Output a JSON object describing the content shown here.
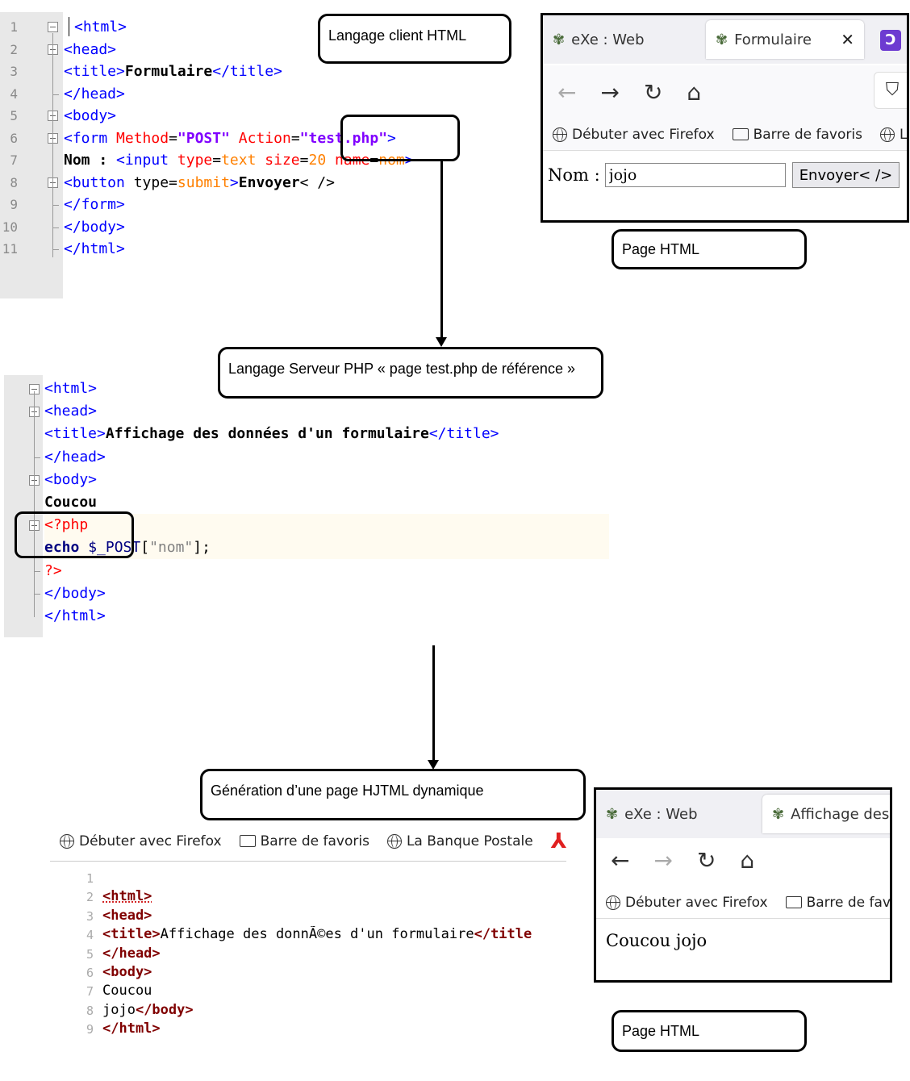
{
  "labels": {
    "client": "Langage client HTML",
    "page_html_1": "Page HTML",
    "server": "Langage Serveur PHP « page test.php de référence »",
    "generation": "Génération d’une page HJTML dynamique",
    "page_html_2": "Page HTML"
  },
  "editor1": {
    "lines": [
      {
        "n": "1",
        "html": "<span class=\"tag\">&lt;html&gt;</span>"
      },
      {
        "n": "2",
        "html": "<span class=\"tag\">&lt;head&gt;</span>"
      },
      {
        "n": "3",
        "html": "<span class=\"tag\">&lt;title&gt;</span><span class=\"bold\">Formulaire</span><span class=\"tag\">&lt;/title&gt;</span>"
      },
      {
        "n": "4",
        "html": "<span class=\"tag\">&lt;/head&gt;</span>"
      },
      {
        "n": "5",
        "html": "<span class=\"tag\">&lt;body&gt;</span>"
      },
      {
        "n": "6",
        "html": "<span class=\"tag\">&lt;form </span><span class=\"attr\">Method</span>=<span class=\"str\">\"POST\"</span> <span class=\"attr\">Action</span>=<span class=\"str\">\"test.php\"</span><span class=\"tag\">&gt;</span>"
      },
      {
        "n": "7",
        "html": "<span class=\"bold\">Nom : </span><span class=\"tag\">&lt;input </span><span class=\"attr\">type</span>=<span style=\"color:#ff8000\">text</span> <span class=\"attr\">size</span>=<span style=\"color:#ff8000\">20</span> <span class=\"attr\">name</span>=<span style=\"color:#ff8000\">nom</span><span class=\"tag\">&gt;</span>"
      },
      {
        "n": "8",
        "html": "<span class=\"tag\">&lt;button </span>type=<span style=\"color:#ff8000\">submit</span><span class=\"tag\">&gt;</span><span class=\"bold\">Envoyer</span>&lt; /&gt;"
      },
      {
        "n": "9",
        "html": "<span class=\"tag\">&lt;/form&gt;</span>"
      },
      {
        "n": "10",
        "html": "<span class=\"tag\">&lt;/body&gt;</span>"
      },
      {
        "n": "11",
        "html": "<span class=\"tag\">&lt;/html&gt;</span>"
      }
    ]
  },
  "editor2": {
    "lines": [
      {
        "html": "<span class=\"tag\">&lt;html&gt;</span>"
      },
      {
        "html": "<span class=\"tag\">&lt;head&gt;</span>"
      },
      {
        "html": "<span class=\"tag\">&lt;title&gt;</span><span class=\"bold\">Affichage des données d'un formulaire</span><span class=\"tag\">&lt;/title&gt;</span>"
      },
      {
        "html": "<span class=\"tag\">&lt;/head&gt;</span>"
      },
      {
        "html": "<span class=\"tag\">&lt;body&gt;</span>"
      },
      {
        "html": "<span class=\"bold\">Coucou</span>"
      },
      {
        "html": "<span class=\"php\">&lt;?php</span>"
      },
      {
        "html": "<span class=\"bold\" style=\"color:#000080\">echo</span> <span style=\"color:#000080\">$_POST</span>[<span style=\"color:#808080\">\"nom\"</span>];"
      },
      {
        "html": "<span class=\"php\">?&gt;</span>"
      },
      {
        "html": "<span class=\"tag\">&lt;/body&gt;</span>"
      },
      {
        "html": "<span class=\"tag\">&lt;/html&gt;</span>"
      }
    ]
  },
  "browser1": {
    "tab1": "eXe : Web",
    "tab2": "Formulaire",
    "bm1": "Débuter avec Firefox",
    "bm2": "Barre de favoris",
    "bm3": "La",
    "nom_label": "Nom :",
    "input_value": "jojo",
    "button_label": "Envoyer< />"
  },
  "source_view": {
    "bm1": "Débuter avec Firefox",
    "bm2": "Barre de favoris",
    "bm3": "La Banque Postale",
    "lines": [
      {
        "n": "1",
        "html": ""
      },
      {
        "n": "2",
        "html": "<span style=\"color:#800000;font-weight:bold;text-decoration:underline dotted #c00\">&lt;html&gt;</span>"
      },
      {
        "n": "3",
        "html": "<span style=\"color:#800000;font-weight:bold\">&lt;head&gt;</span>"
      },
      {
        "n": "4",
        "html": "<span style=\"color:#800000;font-weight:bold\">&lt;title&gt;</span>Affichage des donnÃ©es d'un formulaire<span style=\"color:#800000;font-weight:bold\">&lt;/title</span>"
      },
      {
        "n": "5",
        "html": "<span style=\"color:#800000;font-weight:bold\">&lt;/head&gt;</span>"
      },
      {
        "n": "6",
        "html": "<span style=\"color:#800000;font-weight:bold\">&lt;body&gt;</span>"
      },
      {
        "n": "7",
        "html": "Coucou"
      },
      {
        "n": "8",
        "html": "jojo<span style=\"color:#800000;font-weight:bold\">&lt;/body&gt;</span>"
      },
      {
        "n": "9",
        "html": "<span style=\"color:#800000;font-weight:bold\">&lt;/html&gt;</span>"
      }
    ]
  },
  "browser2": {
    "tab1": "eXe : Web",
    "tab2": "Affichage des",
    "bm1": "Débuter avec Firefox",
    "bm2": "Barre de fav",
    "content": "Coucou jojo"
  },
  "icons": [
    "back-arrow-icon",
    "forward-arrow-icon",
    "reload-icon",
    "home-icon",
    "shield-icon",
    "globe-icon",
    "folder-icon",
    "close-icon"
  ]
}
